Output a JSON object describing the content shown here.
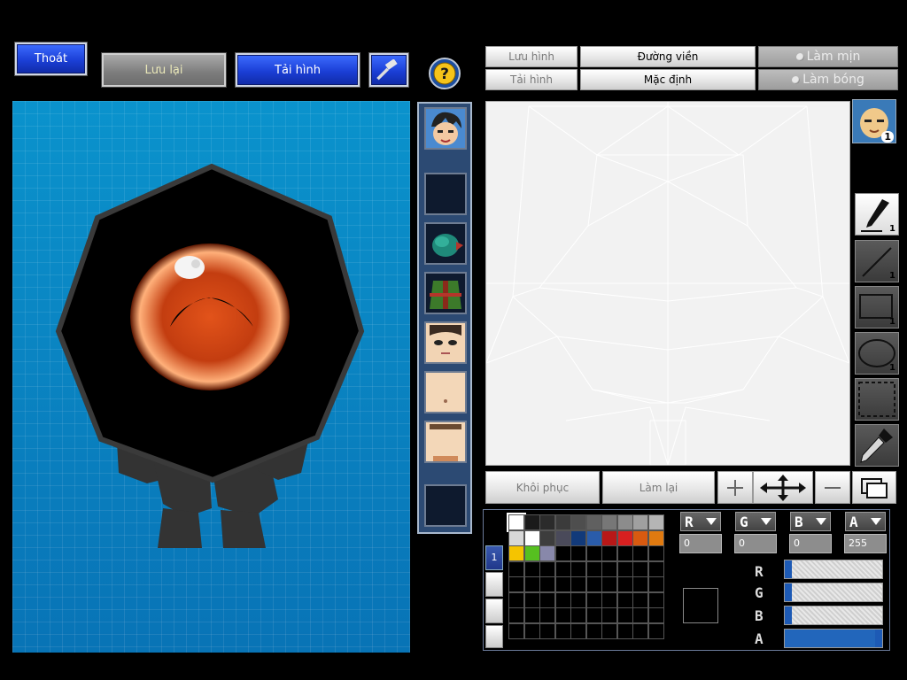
{
  "top_left": {
    "exit_label": "Thoát",
    "save_label": "Lưu lại",
    "load_label": "Tải hình"
  },
  "editor_top": {
    "save_image": "Lưu hình",
    "load_image": "Tải hình",
    "outline": "Đường viền",
    "default": "Mặc định",
    "smooth": "Làm mịn",
    "shade": "Làm bóng"
  },
  "editor_bottom": {
    "restore": "Khôi phục",
    "redo": "Làm lại"
  },
  "layer_badge": "1",
  "tools": [
    {
      "icon": "pen-icon",
      "count": "1"
    },
    {
      "icon": "line-icon",
      "count": "1"
    },
    {
      "icon": "rectangle-icon",
      "count": "1"
    },
    {
      "icon": "ellipse-icon",
      "count": "1"
    },
    {
      "icon": "selection-icon",
      "count": ""
    },
    {
      "icon": "eyedropper-icon",
      "count": ""
    }
  ],
  "palette": {
    "page_tab": "1",
    "row1": [
      "#ffffff",
      "#1a1a1a",
      "#2b2b2b",
      "#3b3b3b",
      "#4e4e4e",
      "#606060",
      "#777777",
      "#8c8c8c",
      "#a0a0a0",
      "#b5b5b5"
    ],
    "row2": [
      "#d8d8d8",
      "#ffffff",
      "#3d3d3d",
      "#4a4a5a",
      "#123a7a",
      "#2a5caa",
      "#b81818",
      "#d82020",
      "#d85a10",
      "#e07a10",
      "#b08010"
    ],
    "row3": [
      "#f5c400",
      "#56c020",
      "#8888aa"
    ]
  },
  "channels": {
    "r_value": "0",
    "g_value": "0",
    "b_value": "0",
    "a_value": "255",
    "r_level": 0,
    "g_level": 0,
    "b_level": 0,
    "a_level": 1
  },
  "colors": {
    "stage_blue": "#0b86c4",
    "panel_blue": "#2c4a73",
    "button_blue": "#1b3fd6"
  }
}
